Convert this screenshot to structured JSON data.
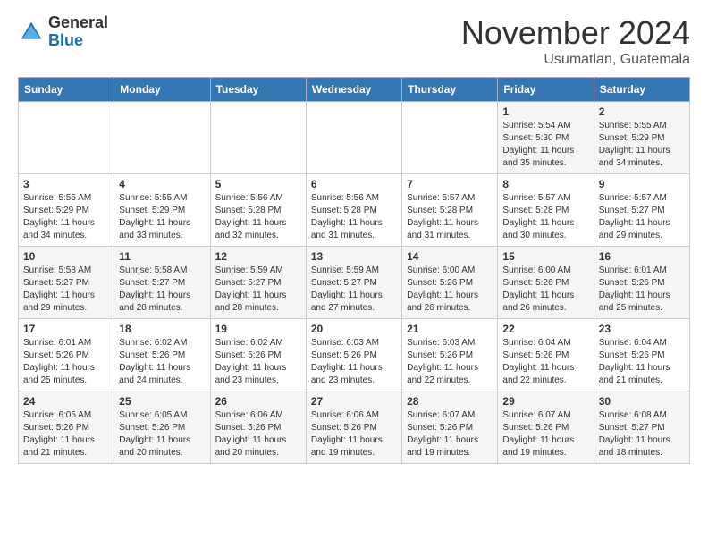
{
  "header": {
    "logo": {
      "general": "General",
      "blue": "Blue"
    },
    "title": "November 2024",
    "location": "Usumatlan, Guatemala"
  },
  "calendar": {
    "days_of_week": [
      "Sunday",
      "Monday",
      "Tuesday",
      "Wednesday",
      "Thursday",
      "Friday",
      "Saturday"
    ],
    "weeks": [
      [
        {
          "day": "",
          "info": ""
        },
        {
          "day": "",
          "info": ""
        },
        {
          "day": "",
          "info": ""
        },
        {
          "day": "",
          "info": ""
        },
        {
          "day": "",
          "info": ""
        },
        {
          "day": "1",
          "info": "Sunrise: 5:54 AM\nSunset: 5:30 PM\nDaylight: 11 hours\nand 35 minutes."
        },
        {
          "day": "2",
          "info": "Sunrise: 5:55 AM\nSunset: 5:29 PM\nDaylight: 11 hours\nand 34 minutes."
        }
      ],
      [
        {
          "day": "3",
          "info": "Sunrise: 5:55 AM\nSunset: 5:29 PM\nDaylight: 11 hours\nand 34 minutes."
        },
        {
          "day": "4",
          "info": "Sunrise: 5:55 AM\nSunset: 5:29 PM\nDaylight: 11 hours\nand 33 minutes."
        },
        {
          "day": "5",
          "info": "Sunrise: 5:56 AM\nSunset: 5:28 PM\nDaylight: 11 hours\nand 32 minutes."
        },
        {
          "day": "6",
          "info": "Sunrise: 5:56 AM\nSunset: 5:28 PM\nDaylight: 11 hours\nand 31 minutes."
        },
        {
          "day": "7",
          "info": "Sunrise: 5:57 AM\nSunset: 5:28 PM\nDaylight: 11 hours\nand 31 minutes."
        },
        {
          "day": "8",
          "info": "Sunrise: 5:57 AM\nSunset: 5:28 PM\nDaylight: 11 hours\nand 30 minutes."
        },
        {
          "day": "9",
          "info": "Sunrise: 5:57 AM\nSunset: 5:27 PM\nDaylight: 11 hours\nand 29 minutes."
        }
      ],
      [
        {
          "day": "10",
          "info": "Sunrise: 5:58 AM\nSunset: 5:27 PM\nDaylight: 11 hours\nand 29 minutes."
        },
        {
          "day": "11",
          "info": "Sunrise: 5:58 AM\nSunset: 5:27 PM\nDaylight: 11 hours\nand 28 minutes."
        },
        {
          "day": "12",
          "info": "Sunrise: 5:59 AM\nSunset: 5:27 PM\nDaylight: 11 hours\nand 28 minutes."
        },
        {
          "day": "13",
          "info": "Sunrise: 5:59 AM\nSunset: 5:27 PM\nDaylight: 11 hours\nand 27 minutes."
        },
        {
          "day": "14",
          "info": "Sunrise: 6:00 AM\nSunset: 5:26 PM\nDaylight: 11 hours\nand 26 minutes."
        },
        {
          "day": "15",
          "info": "Sunrise: 6:00 AM\nSunset: 5:26 PM\nDaylight: 11 hours\nand 26 minutes."
        },
        {
          "day": "16",
          "info": "Sunrise: 6:01 AM\nSunset: 5:26 PM\nDaylight: 11 hours\nand 25 minutes."
        }
      ],
      [
        {
          "day": "17",
          "info": "Sunrise: 6:01 AM\nSunset: 5:26 PM\nDaylight: 11 hours\nand 25 minutes."
        },
        {
          "day": "18",
          "info": "Sunrise: 6:02 AM\nSunset: 5:26 PM\nDaylight: 11 hours\nand 24 minutes."
        },
        {
          "day": "19",
          "info": "Sunrise: 6:02 AM\nSunset: 5:26 PM\nDaylight: 11 hours\nand 23 minutes."
        },
        {
          "day": "20",
          "info": "Sunrise: 6:03 AM\nSunset: 5:26 PM\nDaylight: 11 hours\nand 23 minutes."
        },
        {
          "day": "21",
          "info": "Sunrise: 6:03 AM\nSunset: 5:26 PM\nDaylight: 11 hours\nand 22 minutes."
        },
        {
          "day": "22",
          "info": "Sunrise: 6:04 AM\nSunset: 5:26 PM\nDaylight: 11 hours\nand 22 minutes."
        },
        {
          "day": "23",
          "info": "Sunrise: 6:04 AM\nSunset: 5:26 PM\nDaylight: 11 hours\nand 21 minutes."
        }
      ],
      [
        {
          "day": "24",
          "info": "Sunrise: 6:05 AM\nSunset: 5:26 PM\nDaylight: 11 hours\nand 21 minutes."
        },
        {
          "day": "25",
          "info": "Sunrise: 6:05 AM\nSunset: 5:26 PM\nDaylight: 11 hours\nand 20 minutes."
        },
        {
          "day": "26",
          "info": "Sunrise: 6:06 AM\nSunset: 5:26 PM\nDaylight: 11 hours\nand 20 minutes."
        },
        {
          "day": "27",
          "info": "Sunrise: 6:06 AM\nSunset: 5:26 PM\nDaylight: 11 hours\nand 19 minutes."
        },
        {
          "day": "28",
          "info": "Sunrise: 6:07 AM\nSunset: 5:26 PM\nDaylight: 11 hours\nand 19 minutes."
        },
        {
          "day": "29",
          "info": "Sunrise: 6:07 AM\nSunset: 5:26 PM\nDaylight: 11 hours\nand 19 minutes."
        },
        {
          "day": "30",
          "info": "Sunrise: 6:08 AM\nSunset: 5:27 PM\nDaylight: 11 hours\nand 18 minutes."
        }
      ]
    ]
  }
}
